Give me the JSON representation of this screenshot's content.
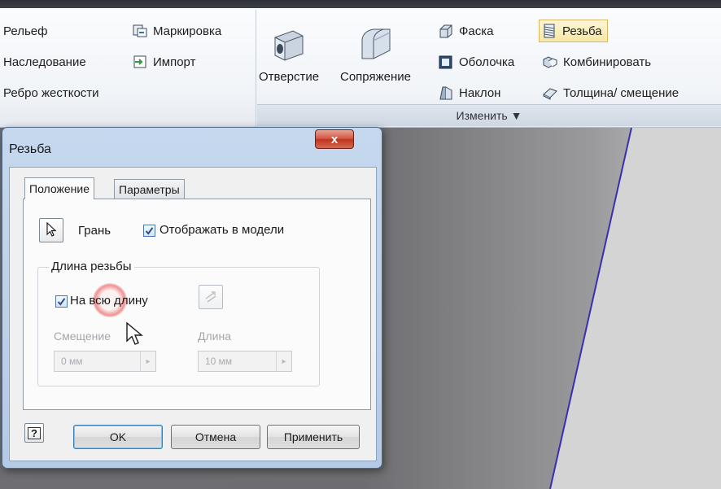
{
  "ribbon": {
    "col1": [
      "Рельеф",
      "Наследование",
      "Ребро жесткости"
    ],
    "col2": [
      "Маркировка",
      "Импорт"
    ],
    "large_buttons": [
      "Отверстие",
      "Сопряжение"
    ],
    "col4": [
      "Фаска",
      "Оболочка",
      "Наклон"
    ],
    "col5": [
      "Резьба",
      "Комбинировать",
      "Толщина/ смещение"
    ],
    "panel_label": "Изменить ▼"
  },
  "dialog": {
    "title": "Резьба",
    "close_label": "x",
    "tabs": [
      "Положение",
      "Параметры"
    ],
    "face_label": "Грань",
    "show_in_model_label": "Отображать в модели",
    "show_in_model_checked": true,
    "group_title": "Длина резьбы",
    "full_length_label": "На всю длину",
    "full_length_checked": true,
    "offset_label": "Смещение",
    "offset_value": "0 мм",
    "length_label": "Длина",
    "length_value": "10 мм",
    "help_label": "?",
    "buttons": {
      "ok": "OK",
      "cancel": "Отмена",
      "apply": "Применить"
    }
  },
  "colors": {
    "accent_blue": "#3a66b0",
    "model_edge": "#3a2fb0"
  }
}
